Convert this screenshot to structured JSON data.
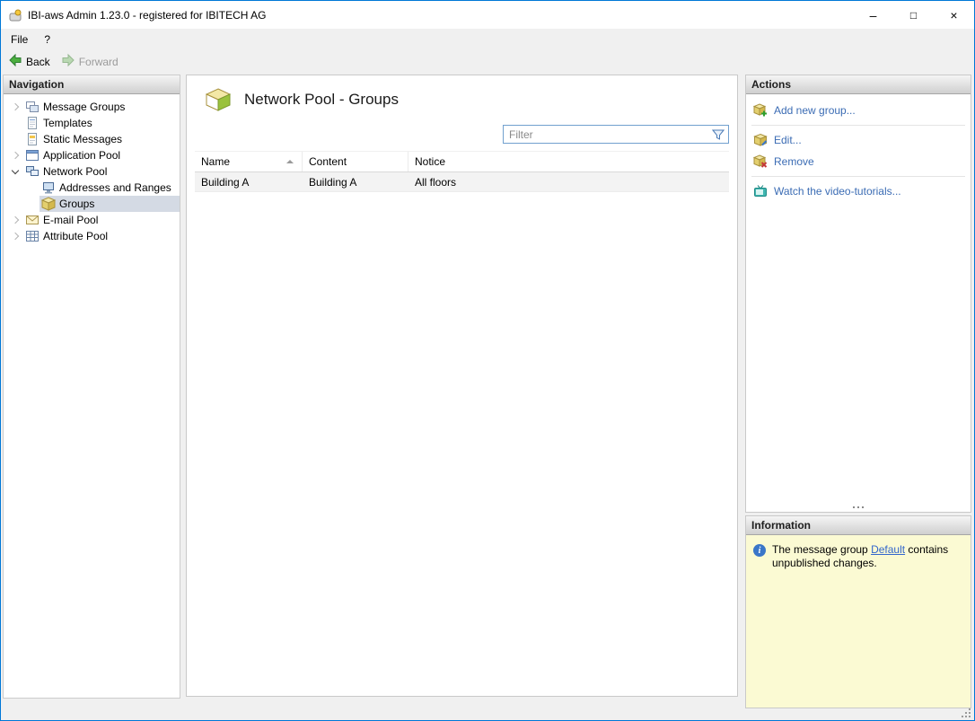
{
  "window": {
    "title": "IBI-aws Admin 1.23.0 - registered for IBITECH AG",
    "controls": {
      "minimize": "–",
      "maximize": "□",
      "close": "×"
    }
  },
  "menu": {
    "items": [
      {
        "label": "File"
      },
      {
        "label": "?"
      }
    ]
  },
  "toolbar": {
    "back": "Back",
    "forward": "Forward"
  },
  "navigation": {
    "header": "Navigation",
    "items": [
      {
        "label": "Message Groups",
        "expanded": false
      },
      {
        "label": "Templates"
      },
      {
        "label": "Static Messages"
      },
      {
        "label": "Application Pool",
        "expanded": false
      },
      {
        "label": "Network Pool",
        "expanded": true
      },
      {
        "label": "Addresses and Ranges",
        "level": 1
      },
      {
        "label": "Groups",
        "level": 1,
        "selected": true
      },
      {
        "label": "E-mail Pool",
        "expanded": false
      },
      {
        "label": "Attribute Pool",
        "expanded": false
      }
    ]
  },
  "main": {
    "title": "Network Pool - Groups",
    "filter_placeholder": "Filter",
    "table": {
      "columns": [
        "Name",
        "Content",
        "Notice"
      ],
      "sort": {
        "column": "Name",
        "direction": "ascending"
      },
      "rows": [
        {
          "name": "Building A",
          "content": "Building A",
          "notice": "All floors"
        }
      ]
    }
  },
  "actions": {
    "header": "Actions",
    "items": [
      {
        "label": "Add new group..."
      },
      {
        "label": "Edit..."
      },
      {
        "label": "Remove"
      },
      {
        "label": "Watch the video-tutorials..."
      }
    ]
  },
  "information": {
    "header": "Information",
    "text_prefix": "The message group ",
    "link_label": "Default",
    "text_suffix": " contains unpublished changes."
  },
  "icons": {
    "info_glyph": "i"
  }
}
